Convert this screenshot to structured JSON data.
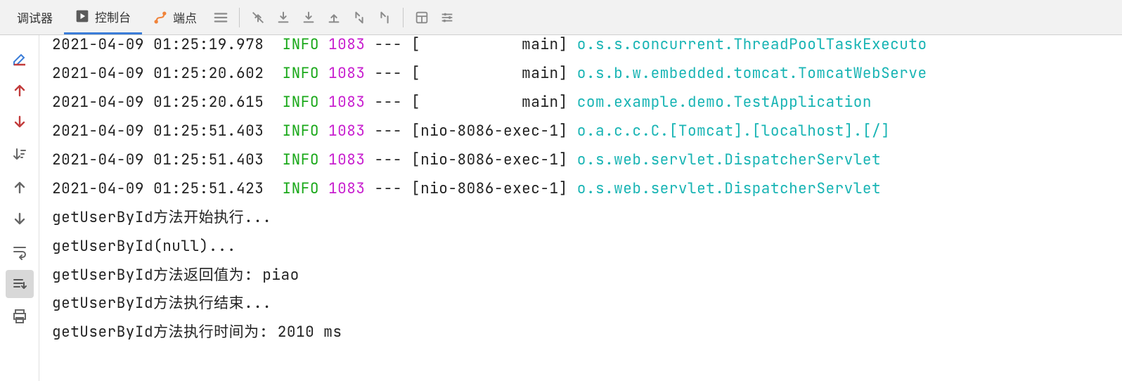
{
  "tabs": {
    "debugger": {
      "label": "调试器"
    },
    "console": {
      "label": "控制台"
    },
    "endpoints": {
      "label": "端点"
    }
  },
  "logs": [
    {
      "ts": "2021-04-09 01:25:19.978",
      "lvl": "INFO",
      "pid": "1083",
      "dash": "---",
      "thr": "[           main]",
      "logger": "o.s.s.concurrent.ThreadPoolTaskExecuto",
      "clipped": true
    },
    {
      "ts": "2021-04-09 01:25:20.602",
      "lvl": "INFO",
      "pid": "1083",
      "dash": "---",
      "thr": "[           main]",
      "logger": "o.s.b.w.embedded.tomcat.TomcatWebServe"
    },
    {
      "ts": "2021-04-09 01:25:20.615",
      "lvl": "INFO",
      "pid": "1083",
      "dash": "---",
      "thr": "[           main]",
      "logger": "com.example.demo.TestApplication"
    },
    {
      "ts": "2021-04-09 01:25:51.403",
      "lvl": "INFO",
      "pid": "1083",
      "dash": "---",
      "thr": "[nio-8086-exec-1]",
      "logger": "o.a.c.c.C.[Tomcat].[localhost].[/]"
    },
    {
      "ts": "2021-04-09 01:25:51.403",
      "lvl": "INFO",
      "pid": "1083",
      "dash": "---",
      "thr": "[nio-8086-exec-1]",
      "logger": "o.s.web.servlet.DispatcherServlet"
    },
    {
      "ts": "2021-04-09 01:25:51.423",
      "lvl": "INFO",
      "pid": "1083",
      "dash": "---",
      "thr": "[nio-8086-exec-1]",
      "logger": "o.s.web.servlet.DispatcherServlet"
    }
  ],
  "plain_lines": [
    "getUserById方法开始执行...",
    "getUserById(null)...",
    "getUserById方法返回值为: piao",
    "getUserById方法执行结束...",
    "getUserById方法执行时间为: 2010 ms"
  ]
}
